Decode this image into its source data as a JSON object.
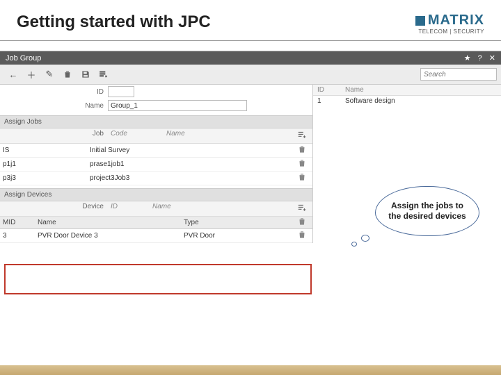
{
  "slide": {
    "title": "Getting started with JPC",
    "brand_main": "MATRIX",
    "brand_sub": "TELECOM | SECURITY"
  },
  "titlebar": {
    "label": "Job Group"
  },
  "toolbar": {
    "search_placeholder": "Search"
  },
  "form": {
    "id_label": "ID",
    "id_value": "",
    "name_label": "Name",
    "name_value": "Group_1"
  },
  "sections": {
    "assign_jobs": "Assign Jobs",
    "assign_devices": "Assign Devices"
  },
  "jobs_header": {
    "job_label": "Job",
    "code": "Code",
    "name": "Name"
  },
  "jobs": [
    {
      "code": "IS",
      "name": "Initial Survey"
    },
    {
      "code": "p1j1",
      "name": "prase1job1"
    },
    {
      "code": "p3j3",
      "name": "project3Job3"
    }
  ],
  "devices_header": {
    "device_label": "Device",
    "id": "ID",
    "name": "Name"
  },
  "devices_colhead": {
    "mid": "MID",
    "name": "Name",
    "type": "Type"
  },
  "devices": [
    {
      "mid": "3",
      "name": "PVR Door Device 3",
      "type": "PVR Door"
    }
  ],
  "right_list": {
    "id_label": "ID",
    "name_label": "Name",
    "rows": [
      {
        "id": "1",
        "name": "Software design"
      }
    ]
  },
  "callout": {
    "text": "Assign the jobs to the desired devices"
  }
}
